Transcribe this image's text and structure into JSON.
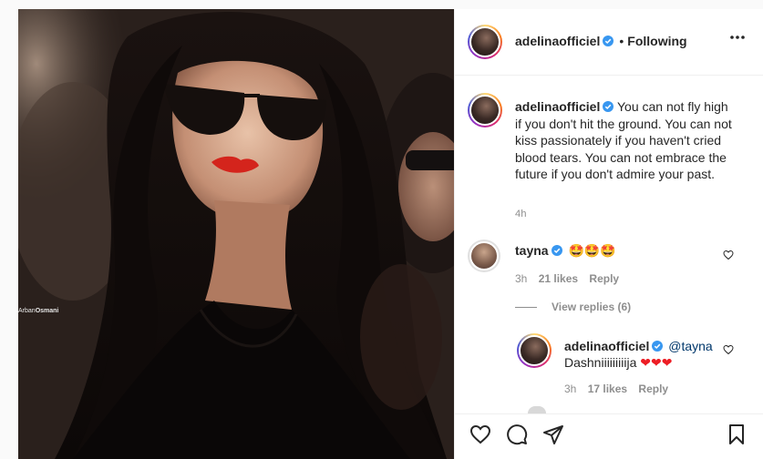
{
  "post": {
    "author": "adelinaofficiel",
    "separator": "•",
    "follow_status": "Following",
    "watermark_first": "Arban",
    "watermark_second": "Osmani"
  },
  "caption": {
    "username": "adelinaofficiel",
    "text": "You can not fly high if you don't hit the ground. You can not kiss passionately if you haven't cried blood tears. You can not embrace the future if you don't admire your past.",
    "time": "4h"
  },
  "comments": [
    {
      "username": "tayna",
      "text": "🤩🤩🤩",
      "time": "3h",
      "likes": "21 likes",
      "reply_label": "Reply"
    }
  ],
  "view_replies": "View replies (6)",
  "reply": {
    "username": "adelinaofficiel",
    "mention": "@tayna",
    "text": "Dashniiiiiiiiija ❤❤❤",
    "time": "3h",
    "likes": "17 likes",
    "reply_label": "Reply"
  },
  "icons": {
    "verified": "verified-badge-icon",
    "more": "more-options-icon",
    "like": "heart-icon",
    "comment": "comment-icon",
    "share": "share-icon",
    "save": "bookmark-icon"
  },
  "colors": {
    "verified_blue": "#3897f0",
    "heart_red": "#ed1c24",
    "muted_text": "#8e8e8e",
    "mention_blue": "#00376b"
  }
}
